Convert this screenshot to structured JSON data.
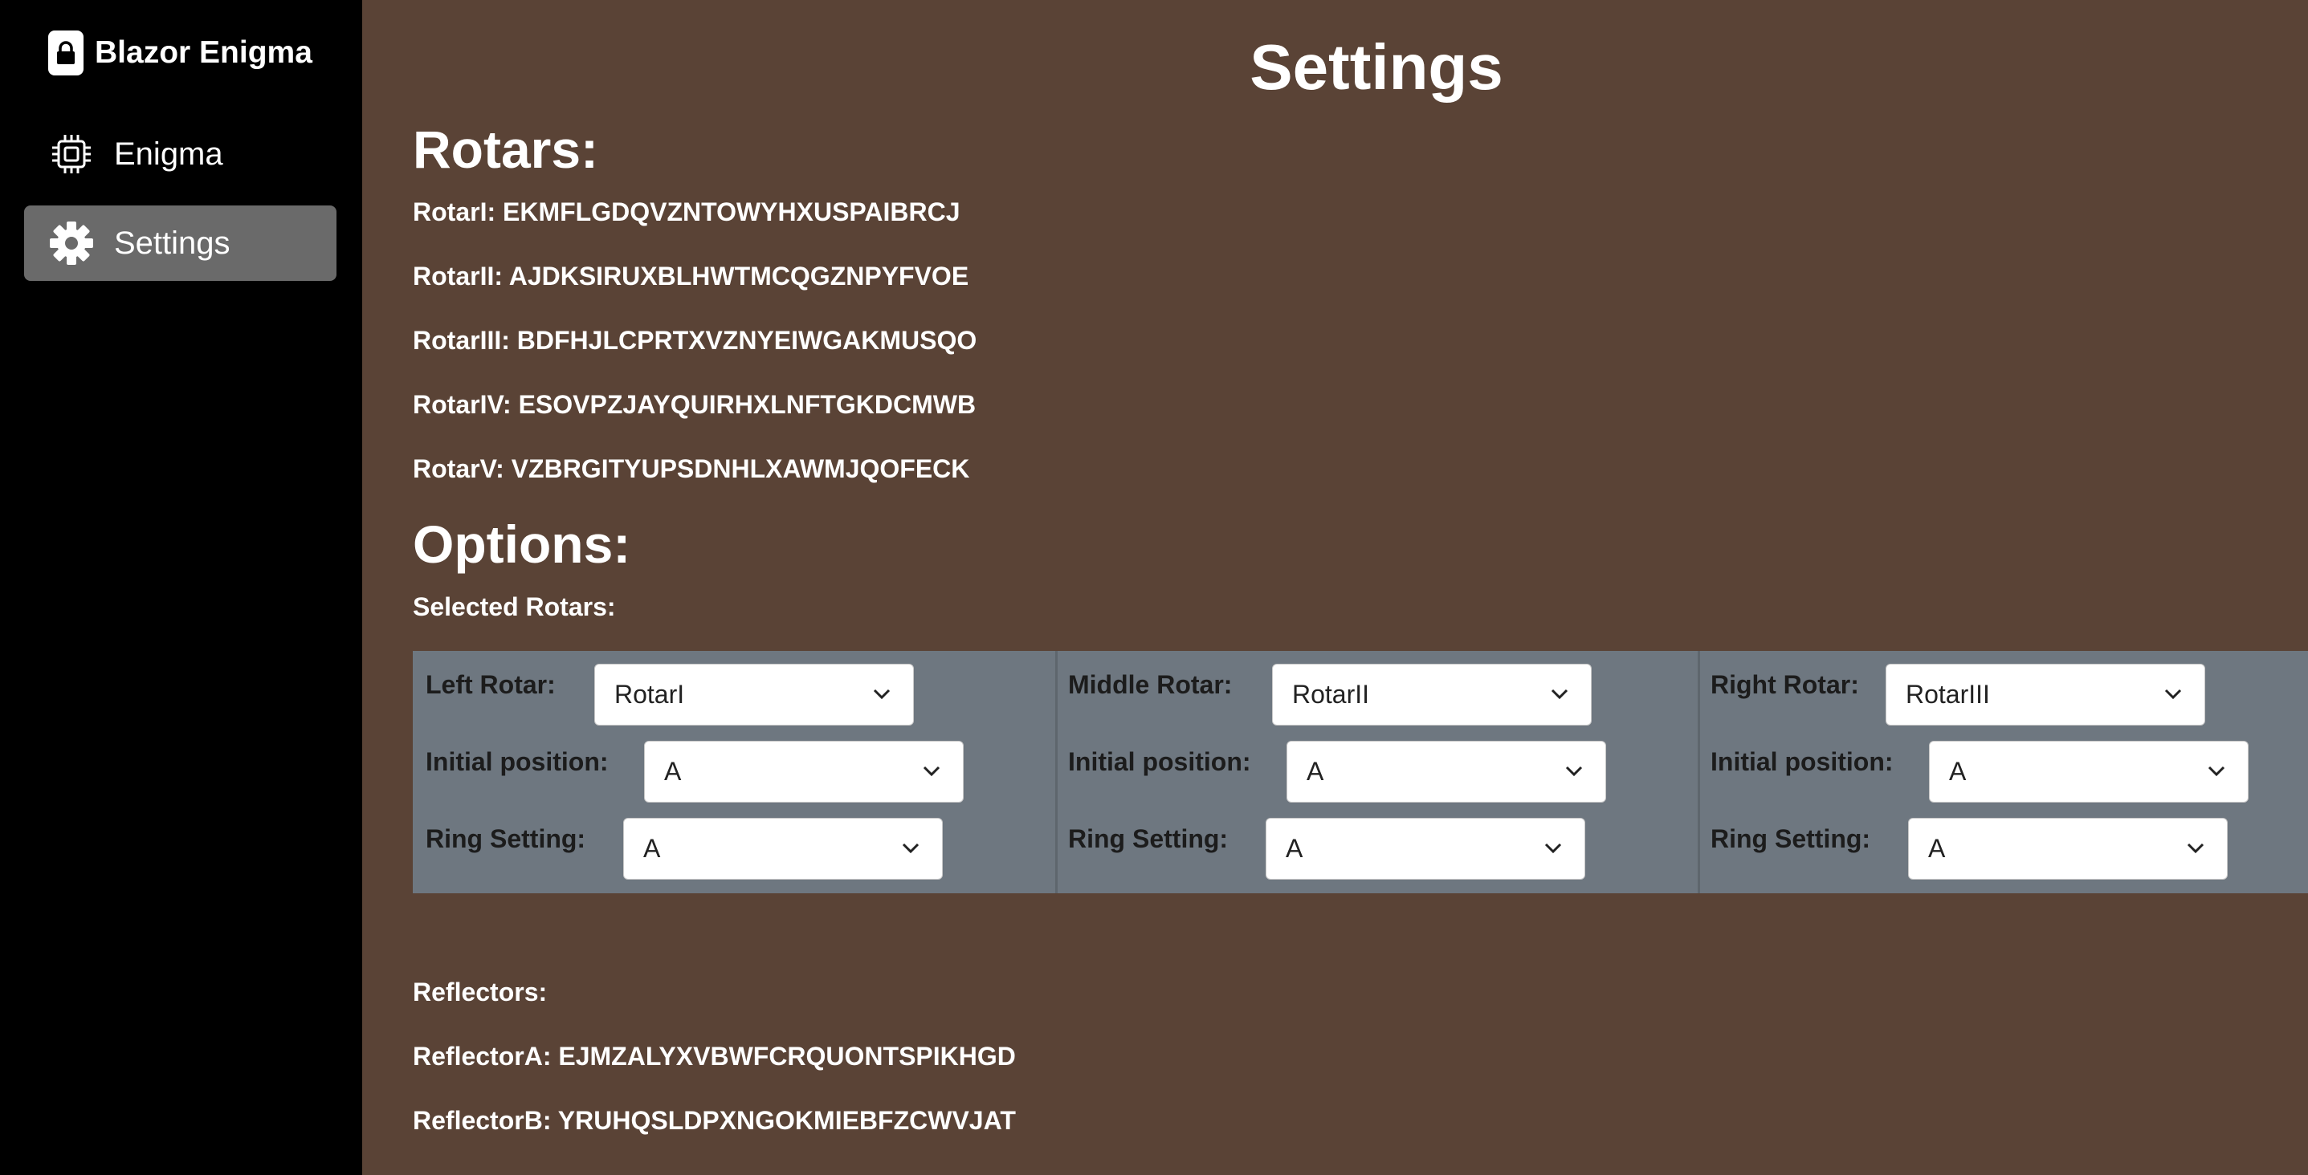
{
  "brand": {
    "name": "Blazor Enigma"
  },
  "nav": [
    {
      "label": "Enigma",
      "icon": "cpu-icon",
      "active": false
    },
    {
      "label": "Settings",
      "icon": "gear-icon",
      "active": true
    }
  ],
  "page": {
    "title": "Settings"
  },
  "rotars": {
    "heading": "Rotars:",
    "items": [
      "RotarI: EKMFLGDQVZNTOWYHXUSPAIBRCJ",
      "RotarII: AJDKSIRUXBLHWTMCQGZNPYFVOE",
      "RotarIII: BDFHJLCPRTXVZNYEIWGAKMUSQO",
      "RotarIV: ESOVPZJAYQUIRHXLNFTGKDCMWB",
      "RotarV: VZBRGITYUPSDNHLXAWMJQOFECK"
    ]
  },
  "options": {
    "heading": "Options:",
    "selected_label": "Selected Rotars:",
    "columns": [
      {
        "rotar_label": "Left Rotar:",
        "rotar_value": "RotarI",
        "position_label": "Initial position:",
        "position_value": "A",
        "ring_label": "Ring Setting:",
        "ring_value": "A"
      },
      {
        "rotar_label": "Middle Rotar:",
        "rotar_value": "RotarII",
        "position_label": "Initial position:",
        "position_value": "A",
        "ring_label": "Ring Setting:",
        "ring_value": "A"
      },
      {
        "rotar_label": "Right Rotar:",
        "rotar_value": "RotarIII",
        "position_label": "Initial position:",
        "position_value": "A",
        "ring_label": "Ring Setting:",
        "ring_value": "A"
      }
    ]
  },
  "reflectors": {
    "heading": "Reflectors:",
    "items": [
      "ReflectorA: EJMZALYXVBWFCRQUONTSPIKHGD",
      "ReflectorB: YRUHQSLDPXNGOKMIEBFZCWVJAT"
    ]
  },
  "colors": {
    "sidebar_bg": "#000000",
    "main_bg": "#5a4336",
    "active_nav_bg": "#6a6a6a",
    "panel_bg": "#6e7780"
  }
}
